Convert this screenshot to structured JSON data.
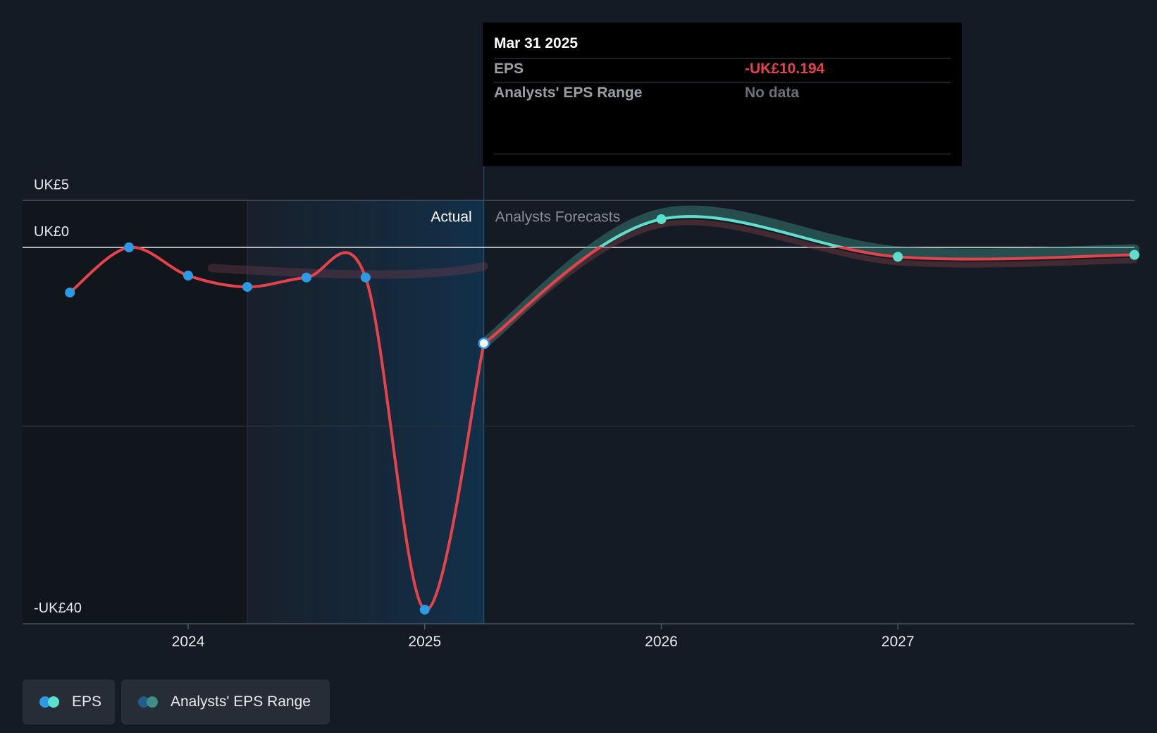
{
  "chart_data": {
    "type": "line",
    "y_ticks": [
      {
        "value": 5,
        "label": "UK£5"
      },
      {
        "value": 0,
        "label": "UK£0"
      },
      {
        "value": -40,
        "label": "-UK£40"
      }
    ],
    "x_ticks": [
      {
        "value": 2024.0,
        "label": "2024"
      },
      {
        "value": 2025.0,
        "label": "2025"
      },
      {
        "value": 2026.0,
        "label": "2026"
      },
      {
        "value": 2027.0,
        "label": "2027"
      }
    ],
    "x_range": [
      2023.3,
      2028.0
    ],
    "y_range": [
      -40,
      10
    ],
    "grid": true,
    "actual_start": 2024.25,
    "divider": 2025.25,
    "region_labels": {
      "actual": "Actual",
      "forecast": "Analysts Forecasts"
    },
    "series": [
      {
        "name": "EPS",
        "color": "#e4434b",
        "actual_points": [
          {
            "x": 2023.5,
            "y": -4.8
          },
          {
            "x": 2023.75,
            "y": 0.0
          },
          {
            "x": 2024.0,
            "y": -3.0
          },
          {
            "x": 2024.25,
            "y": -4.2
          },
          {
            "x": 2024.5,
            "y": -3.2
          },
          {
            "x": 2024.75,
            "y": -3.2
          },
          {
            "x": 2025.0,
            "y": -38.5
          },
          {
            "x": 2025.25,
            "y": -10.194
          }
        ],
        "forecast_points": [
          {
            "x": 2026.0,
            "y": 3.0
          },
          {
            "x": 2027.0,
            "y": -1.0
          },
          {
            "x": 2028.0,
            "y": -0.8
          }
        ],
        "marker_color": "#2b9be6",
        "forecast_marker_color": "#5be0cd"
      }
    ],
    "range_band": {
      "name": "Analysts' EPS Range",
      "color": "#3d8f86"
    }
  },
  "tooltip": {
    "date": "Mar 31 2025",
    "eps_label": "EPS",
    "eps_value": "-UK£10.194",
    "eps_color": "#e4434b",
    "range_label": "Analysts' EPS Range",
    "range_value": "No data"
  },
  "legend": [
    {
      "label": "EPS",
      "colors": [
        "#2b9be6",
        "#5be0cd"
      ]
    },
    {
      "label": "Analysts' EPS Range",
      "colors": [
        "#1f5d8a",
        "#3d8f86"
      ]
    }
  ]
}
